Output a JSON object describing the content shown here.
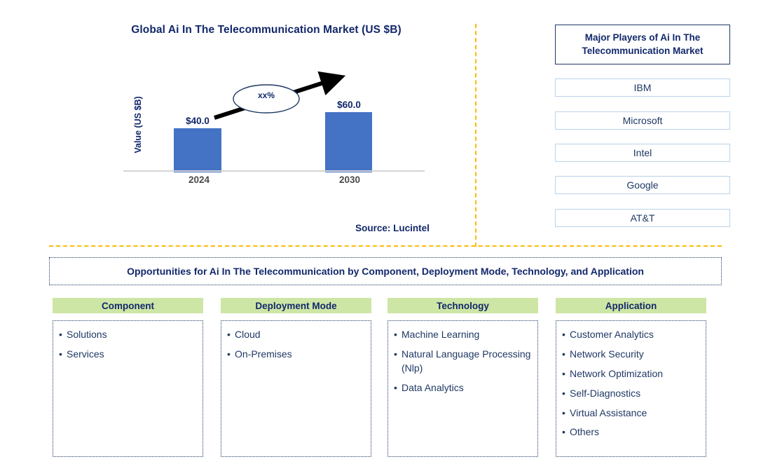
{
  "chart_panel": {
    "title": "Global Ai In The Telecommunication Market (US $B)",
    "y_axis_label": "Value (US $B)",
    "cagr_label": "xx%",
    "source": "Source: Lucintel"
  },
  "chart_data": {
    "type": "bar",
    "title": "Global Ai In The Telecommunication Market (US $B)",
    "categories": [
      "2024",
      "2030"
    ],
    "values": [
      40.0,
      60.0
    ],
    "value_labels": [
      "$40.0",
      "$60.0"
    ],
    "xlabel": "",
    "ylabel": "Value (US $B)",
    "ylim": [
      0,
      70
    ],
    "grid": false,
    "legend": "none",
    "annotations": [
      {
        "text": "xx%",
        "shape": "ellipse",
        "note": "CAGR growth arrow from 2024 bar to 2030 bar"
      }
    ],
    "series_color": "#4472C4",
    "source": "Source: Lucintel"
  },
  "players_panel": {
    "header": "Major Players of Ai In The Telecommunication Market",
    "players": [
      "IBM",
      "Microsoft",
      "Intel",
      "Google",
      "AT&T"
    ]
  },
  "opportunities": {
    "banner": "Opportunities for Ai In The Telecommunication by Component, Deployment Mode, Technology, and Application",
    "columns": [
      {
        "header": "Component",
        "items": [
          "Solutions",
          "Services"
        ]
      },
      {
        "header": "Deployment Mode",
        "items": [
          "Cloud",
          "On-Premises"
        ]
      },
      {
        "header": "Technology",
        "items": [
          "Machine Learning",
          "Natural Language Processing (Nlp)",
          "Data Analytics"
        ]
      },
      {
        "header": "Application",
        "items": [
          "Customer Analytics",
          "Network Security",
          "Network Optimization",
          "Self-Diagnostics",
          "Virtual Assistance",
          "Others"
        ]
      }
    ]
  },
  "colors": {
    "bar": "#4472C4",
    "navy": "#1F3864",
    "header_green": "#CDE6A5",
    "divider_gold": "#FBBC05",
    "player_border": "#BBD3EA"
  }
}
